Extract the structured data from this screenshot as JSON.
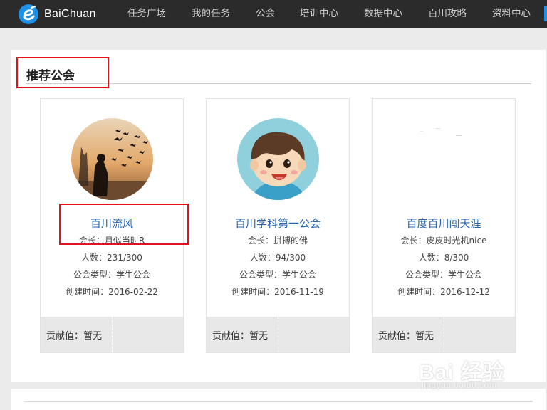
{
  "header": {
    "brand": "BaiChuan",
    "nav": [
      {
        "label": "任务广场"
      },
      {
        "label": "我的任务"
      },
      {
        "label": "公会"
      },
      {
        "label": "培训中心"
      },
      {
        "label": "数据中心"
      },
      {
        "label": "百川攻略"
      },
      {
        "label": "资料中心"
      }
    ]
  },
  "section": {
    "title": "推荐公会"
  },
  "cards": [
    {
      "name": "百川流风",
      "leader": "会长：月似当时R",
      "members": "人数：231/300",
      "type": "公会类型：学生公会",
      "created": "创建时间：2016-02-22",
      "contribution": "贡献值：暂无",
      "avatar_icon": "silhouette-birds-avatar"
    },
    {
      "name": "百川学科第一公会",
      "leader": "会长：拼搏的佛",
      "members": "人数：94/300",
      "type": "公会类型：学生公会",
      "created": "创建时间：2016-11-19",
      "contribution": "贡献值：暂无",
      "avatar_icon": "cartoon-boy-avatar"
    },
    {
      "name": "百度百川闯天涯",
      "leader": "会长：皮皮时光机nice",
      "members": "人数：8/300",
      "type": "公会类型：学生公会",
      "created": "创建时间：2016-12-12",
      "contribution": "贡献值：暂无",
      "avatar_icon": "blank-avatar"
    }
  ],
  "watermark": {
    "main": "Bai 经验",
    "sub": "jingyan.baidu.com"
  },
  "colors": {
    "topbar": "#2b2b2b",
    "brand_blue": "#1e90e6",
    "link_blue": "#2a66b0",
    "highlight_red": "#e0141e"
  }
}
